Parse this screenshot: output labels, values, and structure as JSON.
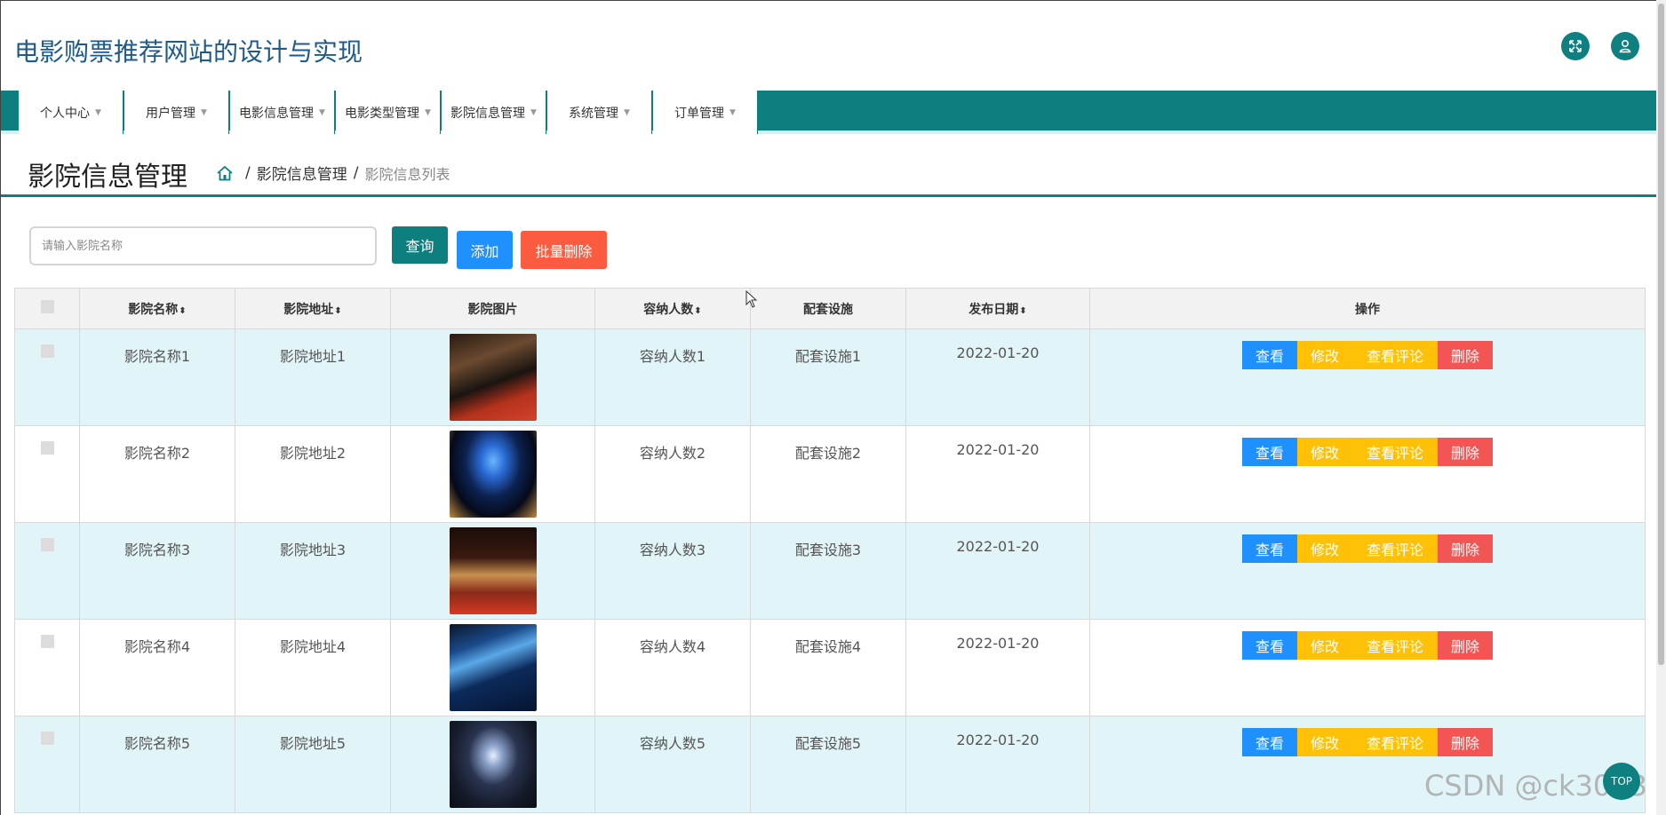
{
  "header": {
    "title": "电影购票推荐网站的设计与实现",
    "fullscreen_icon": "expand-icon",
    "user_icon": "user-icon"
  },
  "nav": {
    "items": [
      {
        "label": "个人中心"
      },
      {
        "label": "用户管理"
      },
      {
        "label": "电影信息管理"
      },
      {
        "label": "电影类型管理"
      },
      {
        "label": "影院信息管理"
      },
      {
        "label": "系统管理"
      },
      {
        "label": "订单管理"
      }
    ]
  },
  "page": {
    "title": "影院信息管理",
    "breadcrumb": [
      "影院信息管理",
      "影院信息列表"
    ]
  },
  "toolbar": {
    "search_placeholder": "请输入影院名称",
    "query_label": "查询",
    "add_label": "添加",
    "batch_delete_label": "批量删除"
  },
  "table": {
    "columns": [
      "影院名称",
      "影院地址",
      "影院图片",
      "容纳人数",
      "配套设施",
      "发布日期",
      "操作"
    ],
    "sort_glyph": "⬍",
    "rows": [
      {
        "name": "影院名称1",
        "address": "影院地址1",
        "capacity": "容纳人数1",
        "facilities": "配套设施1",
        "date": "2022-01-20"
      },
      {
        "name": "影院名称2",
        "address": "影院地址2",
        "capacity": "容纳人数2",
        "facilities": "配套设施2",
        "date": "2022-01-20"
      },
      {
        "name": "影院名称3",
        "address": "影院地址3",
        "capacity": "容纳人数3",
        "facilities": "配套设施3",
        "date": "2022-01-20"
      },
      {
        "name": "影院名称4",
        "address": "影院地址4",
        "capacity": "容纳人数4",
        "facilities": "配套设施4",
        "date": "2022-01-20"
      },
      {
        "name": "影院名称5",
        "address": "影院地址5",
        "capacity": "容纳人数5",
        "facilities": "配套设施5",
        "date": "2022-01-20"
      }
    ],
    "actions": {
      "view": "查看",
      "edit": "修改",
      "view_comments": "查看评论",
      "delete": "删除"
    }
  },
  "watermark": "CSDN @ck3013",
  "totop_label": "TOP",
  "colors": {
    "primary": "#0e7f7f",
    "blue": "#1e90ff",
    "yellow": "#ffc107",
    "red": "#f35454",
    "orange": "#fb5c3f"
  }
}
